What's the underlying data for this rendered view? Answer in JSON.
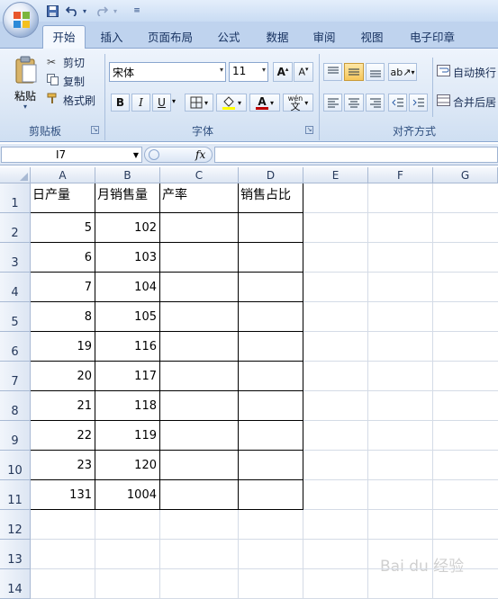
{
  "tabs": [
    "开始",
    "插入",
    "页面布局",
    "公式",
    "数据",
    "审阅",
    "视图",
    "电子印章"
  ],
  "clipboard": {
    "paste": "粘贴",
    "cut": "剪切",
    "copy": "复制",
    "format_painter": "格式刷",
    "group_label": "剪贴板"
  },
  "font": {
    "name": "宋体",
    "size": "11",
    "bold": "B",
    "italic": "I",
    "underline": "U",
    "font_color_letter": "A",
    "wen": "wén",
    "group_label": "字体"
  },
  "alignment": {
    "wrap_text": "自动换行",
    "merge_center": "合并后居",
    "group_label": "对齐方式"
  },
  "formula_bar": {
    "cell_ref": "I7",
    "fx": "fx",
    "content": ""
  },
  "columns": [
    "A",
    "B",
    "C",
    "D",
    "E",
    "F",
    "G"
  ],
  "rows": [
    "1",
    "2",
    "3",
    "4",
    "5",
    "6",
    "7",
    "8",
    "9",
    "10",
    "11",
    "12",
    "13",
    "14"
  ],
  "table": {
    "headers": [
      "日产量",
      "月销售量",
      "产率",
      "销售占比"
    ],
    "rows": [
      [
        "5",
        "102"
      ],
      [
        "6",
        "103"
      ],
      [
        "7",
        "104"
      ],
      [
        "8",
        "105"
      ],
      [
        "19",
        "116"
      ],
      [
        "20",
        "117"
      ],
      [
        "21",
        "118"
      ],
      [
        "22",
        "119"
      ],
      [
        "23",
        "120"
      ],
      [
        "131",
        "1004"
      ]
    ]
  },
  "watermark": "Bai du 经验",
  "colors": {
    "ribbon": "#dde8f6",
    "tab_text": "#15305f",
    "grid_line": "#d4dbe6"
  }
}
